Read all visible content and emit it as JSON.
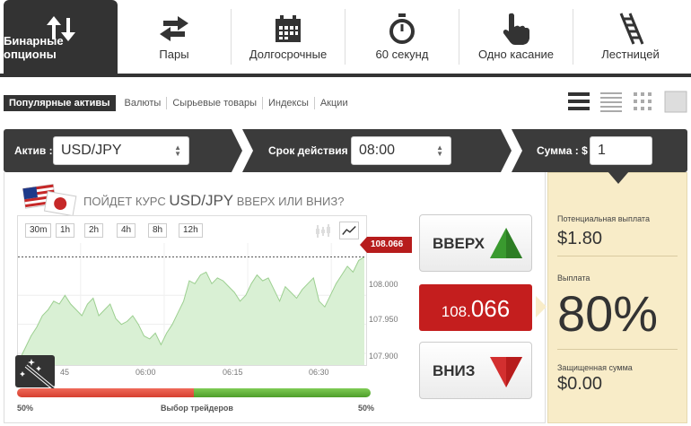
{
  "tabs": [
    {
      "label": "Бинарные опционы",
      "icon": "arrows-up-down-icon",
      "active": true
    },
    {
      "label": "Пары",
      "icon": "arrows-left-right-icon",
      "active": false
    },
    {
      "label": "Долгосрочные",
      "icon": "calendar-icon",
      "active": false
    },
    {
      "label": "60 секунд",
      "icon": "stopwatch-icon",
      "active": false
    },
    {
      "label": "Одно касание",
      "icon": "hand-pointer-icon",
      "active": false
    },
    {
      "label": "Лестницей",
      "icon": "ladder-icon",
      "active": false
    }
  ],
  "subnav": [
    "Популярные активы",
    "Валюты",
    "Сырьевые товары",
    "Индексы",
    "Акции"
  ],
  "view_icons": [
    "list-view-icon",
    "compact-list-view-icon",
    "grid-view-icon",
    "single-view-icon"
  ],
  "bar": {
    "asset_label": "Актив :",
    "asset_value": "USD/JPY",
    "expiry_label": "Срок действия :",
    "expiry_value": "08:00",
    "amount_label": "Сумма : $",
    "amount_value": "1"
  },
  "question": {
    "prefix": "ПОЙДЕТ КУРС",
    "asset": "USD/JPY",
    "suffix": "ВВЕРХ ИЛИ ВНИЗ?"
  },
  "timeframes": [
    "30m",
    "1h",
    "2h",
    "4h",
    "8h",
    "12h"
  ],
  "chart_data": {
    "type": "area",
    "series": [
      {
        "values": [
          107.89,
          107.91,
          107.93,
          107.945,
          107.965,
          107.975,
          107.99,
          107.985,
          108.0,
          107.985,
          107.975,
          107.965,
          107.985,
          107.995,
          107.965,
          107.975,
          107.985,
          107.96,
          107.95,
          107.955,
          107.965,
          107.95,
          107.93,
          107.925,
          107.935,
          107.915,
          107.935,
          107.95,
          107.97,
          107.99,
          108.025,
          108.02,
          108.035,
          108.04,
          108.02,
          108.03,
          108.025,
          108.015,
          108.005,
          107.99,
          108.0,
          108.02,
          108.035,
          108.025,
          108.03,
          108.01,
          107.99,
          108.015,
          108.005,
          107.995,
          108.01,
          108.02,
          108.03,
          107.99,
          107.98,
          108.0,
          108.02,
          108.035,
          108.05,
          108.04,
          108.06,
          108.066
        ]
      }
    ],
    "y_ticks": [
      "108.000",
      "107.950",
      "107.900"
    ],
    "x_ticks": [
      "45",
      "06:00",
      "06:15",
      "06:30"
    ],
    "ylim": [
      107.88,
      108.09
    ],
    "current": "108.066"
  },
  "buttons": {
    "up": "ВВЕРХ",
    "down": "ВНИЗ"
  },
  "current_price": {
    "main": "108.",
    "tail": "066"
  },
  "traders": {
    "left_pct": "50%",
    "label": "Выбор трейдеров",
    "right_pct": "50%",
    "split": 0.5
  },
  "payout": {
    "potential_label": "Потенциальная выплата",
    "potential_value": "$1.80",
    "payout_label": "Выплата",
    "payout_value": "80%",
    "protected_label": "Защищенная сумма",
    "protected_value": "$0.00"
  },
  "colors": {
    "up": "#3a9a2f",
    "down": "#c41e1e",
    "dark": "#333333",
    "payout_bg": "#f8ecc8"
  }
}
